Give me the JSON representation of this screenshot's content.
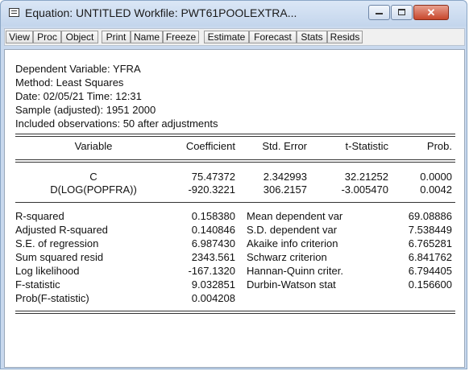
{
  "window": {
    "title": "Equation: UNTITLED   Workfile: PWT61POOLEXTRA...",
    "close_glyph": "✕"
  },
  "toolbar": {
    "buttons": [
      "View",
      "Proc",
      "Object",
      "Print",
      "Name",
      "Freeze",
      "Estimate",
      "Forecast",
      "Stats",
      "Resids"
    ]
  },
  "header": {
    "dependent": "Dependent Variable: YFRA",
    "method": "Method: Least Squares",
    "date": "Date: 02/05/21   Time: 12:31",
    "sample": "Sample (adjusted): 1951 2000",
    "observations": "Included observations: 50 after adjustments"
  },
  "coef_table": {
    "columns": [
      "Variable",
      "Coefficient",
      "Std. Error",
      "t-Statistic",
      "Prob."
    ],
    "rows": [
      [
        "C",
        "75.47372",
        "2.342993",
        "32.21252",
        "0.0000"
      ],
      [
        "D(LOG(POPFRA))",
        "-920.3221",
        "306.2157",
        "-3.005470",
        "0.0042"
      ]
    ]
  },
  "stats": {
    "left": [
      [
        "R-squared",
        "0.158380"
      ],
      [
        "Adjusted R-squared",
        "0.140846"
      ],
      [
        "S.E. of regression",
        "6.987430"
      ],
      [
        "Sum squared resid",
        "2343.561"
      ],
      [
        "Log likelihood",
        "-167.1320"
      ],
      [
        "F-statistic",
        "9.032851"
      ],
      [
        "Prob(F-statistic)",
        "0.004208"
      ]
    ],
    "right": [
      [
        "Mean dependent var",
        "69.08886"
      ],
      [
        "S.D. dependent var",
        "7.538449"
      ],
      [
        "Akaike info criterion",
        "6.765281"
      ],
      [
        "Schwarz criterion",
        "6.841762"
      ],
      [
        "Hannan-Quinn criter.",
        "6.794405"
      ],
      [
        "Durbin-Watson stat",
        "0.156600"
      ]
    ]
  }
}
